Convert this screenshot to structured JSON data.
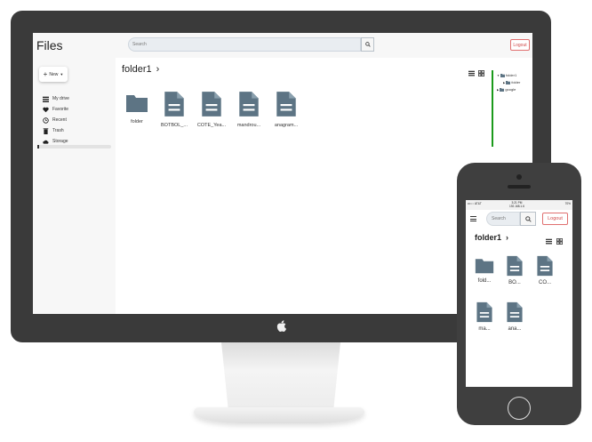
{
  "desktop": {
    "app_title": "Files",
    "search": {
      "placeholder": "Search"
    },
    "logout_label": "Logout",
    "new_button_label": "New",
    "nav": [
      {
        "label": "My drive",
        "icon": "list-icon"
      },
      {
        "label": "Favorite",
        "icon": "heart-icon"
      },
      {
        "label": "Recent",
        "icon": "clock-icon"
      },
      {
        "label": "Trash",
        "icon": "trash-icon"
      },
      {
        "label": "Storage",
        "icon": "cloud-icon"
      }
    ],
    "breadcrumb": "folder1",
    "files": [
      {
        "name": "folder",
        "kind": "folder"
      },
      {
        "name": "BOTBOL_...",
        "kind": "document"
      },
      {
        "name": "COTE_Yea...",
        "kind": "document"
      },
      {
        "name": "mandrou...",
        "kind": "document"
      },
      {
        "name": "anagram...",
        "kind": "document"
      }
    ],
    "tree": [
      {
        "label": "folder1"
      },
      {
        "label": "folder"
      },
      {
        "label": "google"
      }
    ]
  },
  "phone": {
    "status": {
      "carrier": "•••○○ AT&T",
      "time": "3:21 PM",
      "ip": "192.168.1.6",
      "battery": "70%"
    },
    "search": {
      "placeholder": "Search"
    },
    "logout_label": "Logout",
    "breadcrumb": "folder1",
    "files": [
      {
        "name": "fold...",
        "kind": "folder"
      },
      {
        "name": "BO...",
        "kind": "document"
      },
      {
        "name": "CO...",
        "kind": "document"
      },
      {
        "name": "ma...",
        "kind": "document"
      },
      {
        "name": "ana...",
        "kind": "document"
      }
    ]
  },
  "colors": {
    "icon": "#5d7484",
    "tree_line": "#1b9a1b",
    "logout": "#d04a4a",
    "bezel": "#3a3a3a"
  }
}
